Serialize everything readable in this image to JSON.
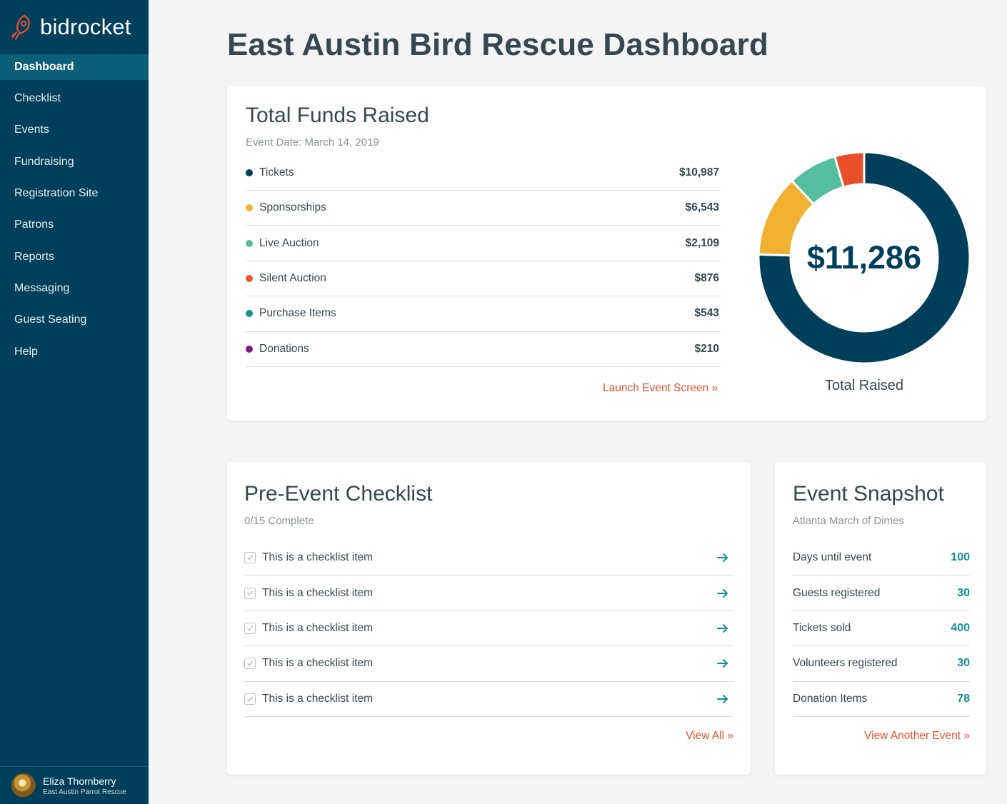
{
  "brand": {
    "name": "bidrocket",
    "icon": "rocket-icon"
  },
  "nav": [
    {
      "label": "Dashboard",
      "active": true
    },
    {
      "label": "Checklist"
    },
    {
      "label": "Events"
    },
    {
      "label": "Fundraising"
    },
    {
      "label": "Registration Site"
    },
    {
      "label": "Patrons"
    },
    {
      "label": "Reports"
    },
    {
      "label": "Messaging"
    },
    {
      "label": "Guest Seating"
    },
    {
      "label": "Help"
    }
  ],
  "user": {
    "name": "Eliza Thornberry",
    "org": "East Austin Parrot Rescue"
  },
  "page_title": "East Austin Bird Rescue Dashboard",
  "funds": {
    "title": "Total Funds Raised",
    "subtitle": "Event Date: March 14, 2019",
    "rows": [
      {
        "label": "Tickets",
        "value": "$10,987",
        "color": "#003f5c"
      },
      {
        "label": "Sponsorships",
        "value": "$6,543",
        "color": "#f0b132"
      },
      {
        "label": "Live Auction",
        "value": "$2,109",
        "color": "#56bd9f"
      },
      {
        "label": "Silent Auction",
        "value": "$876",
        "color": "#e8502a"
      },
      {
        "label": "Purchase Items",
        "value": "$543",
        "color": "#138f96"
      },
      {
        "label": "Donations",
        "value": "$210",
        "color": "#7b1b7e"
      }
    ],
    "link": "Launch Event Screen »",
    "total": "$11,286",
    "total_caption": "Total Raised"
  },
  "chart_data": {
    "type": "pie",
    "style": "donut",
    "center_label": "$11,286",
    "caption": "Total Raised",
    "series": [
      {
        "name": "Tickets",
        "value": 0.755,
        "color": "#003f5c"
      },
      {
        "name": "Sponsorships",
        "value": 0.125,
        "color": "#f0b132"
      },
      {
        "name": "Live Auction",
        "value": 0.075,
        "color": "#56bd9f"
      },
      {
        "name": "Silent Auction",
        "value": 0.045,
        "color": "#e8502a"
      }
    ]
  },
  "checklist": {
    "title": "Pre-Event Checklist",
    "subtitle": "0/15 Complete",
    "items": [
      "This is a checklist item",
      "This is a checklist item",
      "This is a checklist item",
      "This is a checklist item",
      "This is a checklist item"
    ],
    "link": "View All »"
  },
  "snapshot": {
    "title": "Event Snapshot",
    "subtitle": "Atlanta March of Dimes",
    "rows": [
      {
        "label": "Days until event",
        "value": "100"
      },
      {
        "label": "Guests registered",
        "value": "30"
      },
      {
        "label": "Tickets sold",
        "value": "400"
      },
      {
        "label": "Volunteers registered",
        "value": "30"
      },
      {
        "label": "Donation Items",
        "value": "78"
      }
    ],
    "link": "View Another Event »"
  },
  "colors": {
    "sidebar": "#003f5c",
    "active": "#0b5f79",
    "accent_link": "#e8502a",
    "teal": "#138f96"
  }
}
